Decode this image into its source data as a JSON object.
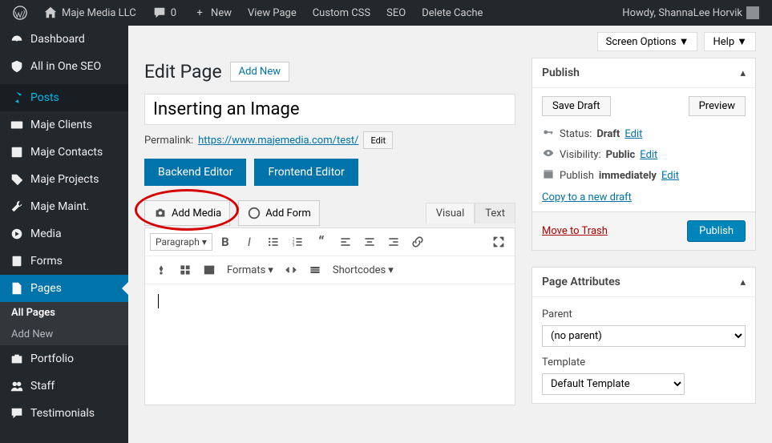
{
  "adminbar": {
    "site_name": "Maje Media LLC",
    "comments_count": "0",
    "new": "New",
    "view_page": "View Page",
    "custom_css": "Custom CSS",
    "seo": "SEO",
    "delete_cache": "Delete Cache",
    "howdy": "Howdy, ShannaLee Horvik"
  },
  "sidebar": {
    "dashboard": "Dashboard",
    "aioseo": "All in One SEO",
    "posts": "Posts",
    "maje_clients": "Maje Clients",
    "maje_contacts": "Maje Contacts",
    "maje_projects": "Maje Projects",
    "maje_maint": "Maje Maint.",
    "media": "Media",
    "forms": "Forms",
    "pages": "Pages",
    "all_pages": "All Pages",
    "add_new": "Add New",
    "portfolio": "Portfolio",
    "staff": "Staff",
    "testimonials": "Testimonials"
  },
  "top": {
    "screen_options": "Screen Options",
    "help": "Help"
  },
  "page": {
    "heading": "Edit Page",
    "add_new": "Add New",
    "title_value": "Inserting an Image",
    "permalink_label": "Permalink:",
    "permalink_url": "https://www.majemedia.com/test/",
    "permalink_edit": "Edit",
    "backend_editor": "Backend Editor",
    "frontend_editor": "Frontend Editor",
    "add_media": "Add Media",
    "add_form": "Add Form",
    "visual_tab": "Visual",
    "text_tab": "Text"
  },
  "toolbar": {
    "paragraph": "Paragraph",
    "formats": "Formats",
    "shortcodes": "Shortcodes"
  },
  "publish": {
    "title": "Publish",
    "save_draft": "Save Draft",
    "preview": "Preview",
    "status_label": "Status:",
    "status_value": "Draft",
    "visibility_label": "Visibility:",
    "visibility_value": "Public",
    "publish_label": "Publish",
    "publish_when": "immediately",
    "edit": "Edit",
    "copy_draft": "Copy to a new draft",
    "trash": "Move to Trash",
    "submit": "Publish"
  },
  "attrs": {
    "title": "Page Attributes",
    "parent_label": "Parent",
    "parent_value": "(no parent)",
    "template_label": "Template",
    "template_value": "Default Template"
  }
}
